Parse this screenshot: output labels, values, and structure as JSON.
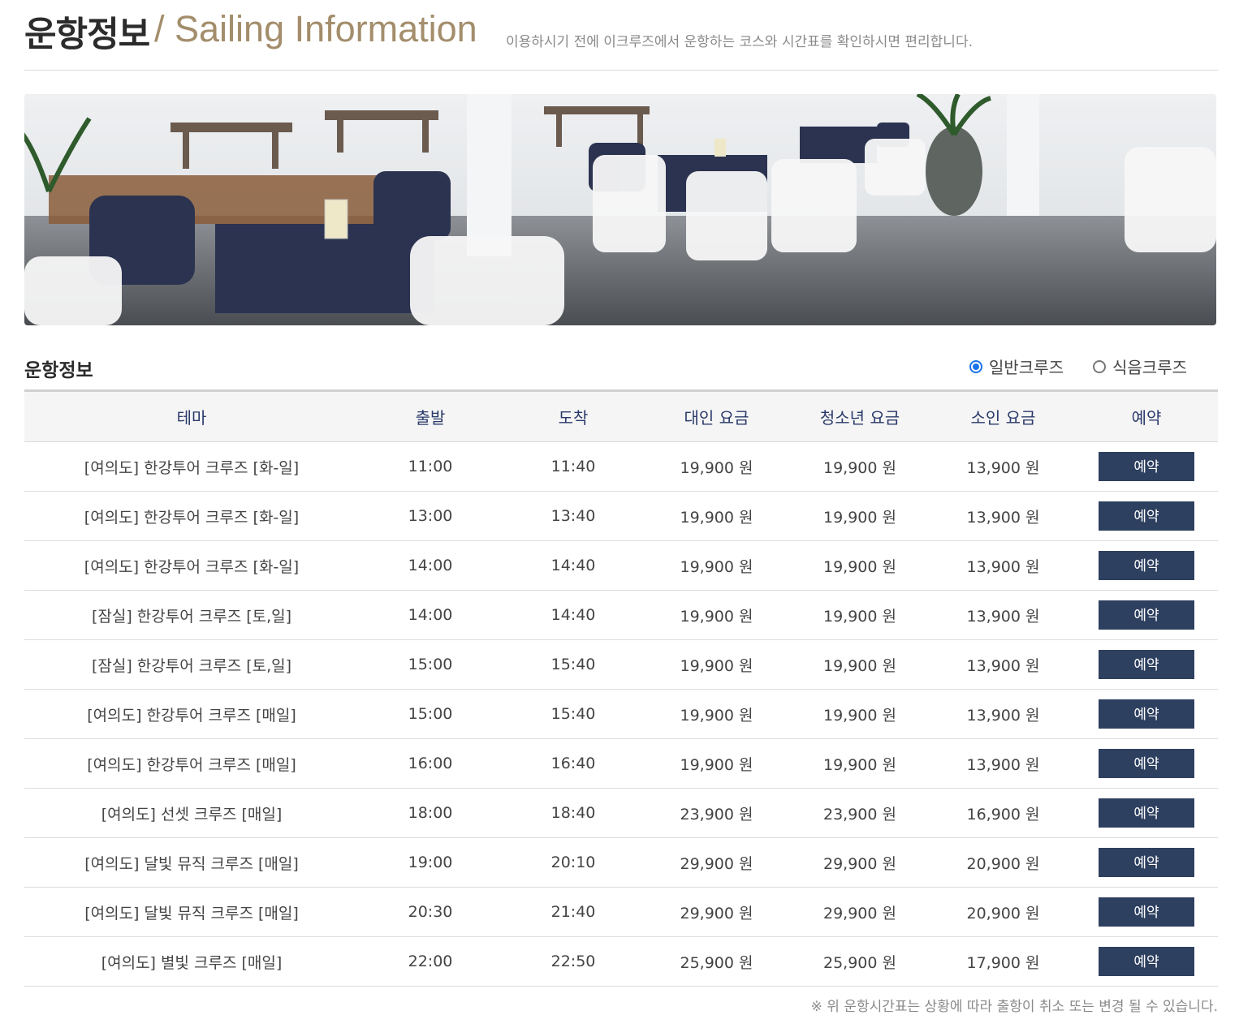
{
  "header": {
    "title_ko": "운항정보",
    "title_en": "/ Sailing Information",
    "description": "이용하시기 전에 이크루즈에서 운항하는 코스와 시간표를 확인하시면 편리합니다."
  },
  "section": {
    "title": "운항정보",
    "options": [
      {
        "label": "일반크루즈",
        "selected": true
      },
      {
        "label": "식음크루즈",
        "selected": false
      }
    ]
  },
  "table": {
    "headers": [
      "테마",
      "출발",
      "도착",
      "대인 요금",
      "청소년 요금",
      "소인 요금",
      "예약"
    ],
    "rows": [
      {
        "theme": "[여의도] 한강투어 크루즈 [화-일]",
        "depart": "11:00",
        "arrive": "11:40",
        "adult": "19,900 원",
        "youth": "19,900 원",
        "child": "13,900 원",
        "reserve": "예약"
      },
      {
        "theme": "[여의도] 한강투어 크루즈 [화-일]",
        "depart": "13:00",
        "arrive": "13:40",
        "adult": "19,900 원",
        "youth": "19,900 원",
        "child": "13,900 원",
        "reserve": "예약"
      },
      {
        "theme": "[여의도] 한강투어 크루즈 [화-일]",
        "depart": "14:00",
        "arrive": "14:40",
        "adult": "19,900 원",
        "youth": "19,900 원",
        "child": "13,900 원",
        "reserve": "예약"
      },
      {
        "theme": "[잠실] 한강투어 크루즈 [토,일]",
        "depart": "14:00",
        "arrive": "14:40",
        "adult": "19,900 원",
        "youth": "19,900 원",
        "child": "13,900 원",
        "reserve": "예약"
      },
      {
        "theme": "[잠실] 한강투어 크루즈 [토,일]",
        "depart": "15:00",
        "arrive": "15:40",
        "adult": "19,900 원",
        "youth": "19,900 원",
        "child": "13,900 원",
        "reserve": "예약"
      },
      {
        "theme": "[여의도] 한강투어 크루즈 [매일]",
        "depart": "15:00",
        "arrive": "15:40",
        "adult": "19,900 원",
        "youth": "19,900 원",
        "child": "13,900 원",
        "reserve": "예약"
      },
      {
        "theme": "[여의도] 한강투어 크루즈 [매일]",
        "depart": "16:00",
        "arrive": "16:40",
        "adult": "19,900 원",
        "youth": "19,900 원",
        "child": "13,900 원",
        "reserve": "예약"
      },
      {
        "theme": "[여의도] 선셋 크루즈 [매일]",
        "depart": "18:00",
        "arrive": "18:40",
        "adult": "23,900 원",
        "youth": "23,900 원",
        "child": "16,900 원",
        "reserve": "예약"
      },
      {
        "theme": "[여의도] 달빛 뮤직 크루즈 [매일]",
        "depart": "19:00",
        "arrive": "20:10",
        "adult": "29,900 원",
        "youth": "29,900 원",
        "child": "20,900 원",
        "reserve": "예약"
      },
      {
        "theme": "[여의도] 달빛 뮤직 크루즈 [매일]",
        "depart": "20:30",
        "arrive": "21:40",
        "adult": "29,900 원",
        "youth": "29,900 원",
        "child": "20,900 원",
        "reserve": "예약"
      },
      {
        "theme": "[여의도] 별빛 크루즈 [매일]",
        "depart": "22:00",
        "arrive": "22:50",
        "adult": "25,900 원",
        "youth": "25,900 원",
        "child": "17,900 원",
        "reserve": "예약"
      }
    ]
  },
  "footnote": "※ 위 운항시간표는 상황에 따라 출항이 취소 또는 변경 될 수 있습니다.",
  "colors": {
    "accent_title": "#a38d6b",
    "button": "#2e4060",
    "radio": "#1a73e8",
    "header_text": "#2a3a6a"
  }
}
